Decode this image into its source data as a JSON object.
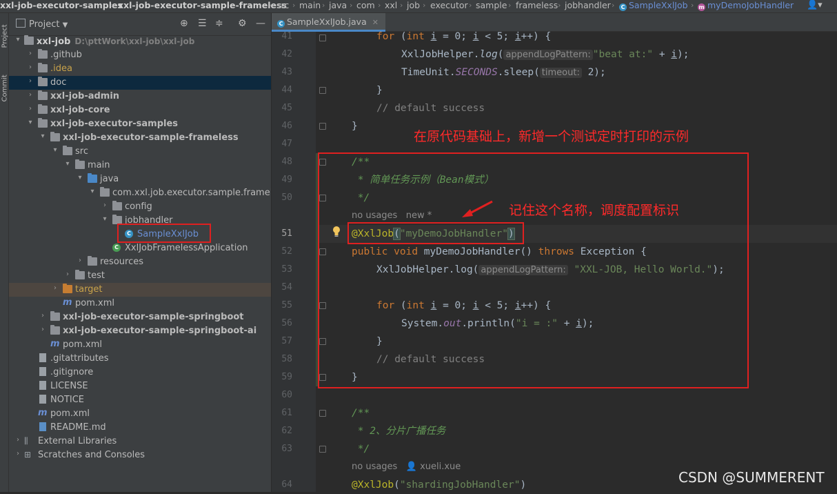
{
  "breadcrumb": {
    "items": [
      "xxl-job-executor-samples",
      "xxl-job-executor-sample-frameless",
      "src",
      "main",
      "java",
      "com",
      "xxl",
      "job",
      "executor",
      "sample",
      "frameless",
      "jobhandler",
      "SampleXxlJob",
      "myDemoJobHandler"
    ],
    "user_icon": "user-icon"
  },
  "toolstrip": {
    "project": "Project",
    "commit": "Commit"
  },
  "project_panel": {
    "title": "Project",
    "root": "xxl-job",
    "root_path": "D:\\pttWork\\xxl-job\\xxl-job",
    "tree": [
      ".github",
      ".idea",
      "doc",
      "xxl-job-admin",
      "xxl-job-core",
      "xxl-job-executor-samples",
      "xxl-job-executor-sample-frameless",
      "src",
      "main",
      "java",
      "com.xxl.job.executor.sample.frameless",
      "config",
      "jobhandler",
      "SampleXxlJob",
      "XxlJobFramelessApplication",
      "resources",
      "test",
      "target",
      "pom.xml",
      "xxl-job-executor-sample-springboot",
      "xxl-job-executor-sample-springboot-ai",
      "pom.xml",
      ".gitattributes",
      ".gitignore",
      "LICENSE",
      "NOTICE",
      "pom.xml",
      "README.md",
      "External Libraries",
      "Scratches and Consoles"
    ]
  },
  "editor": {
    "tab": "SampleXxlJob.java",
    "line_numbers": [
      "41",
      "42",
      "43",
      "44",
      "45",
      "46",
      "47",
      "48",
      "49",
      "50",
      "51",
      "52",
      "53",
      "54",
      "55",
      "56",
      "57",
      "58",
      "59",
      "60",
      "61",
      "62",
      "63",
      "64"
    ],
    "lines": {
      "l41_for": "for",
      "l41_int": "int",
      "l41_i": "i",
      "l41_rest": " = 0; ",
      "l41_i2": "i",
      "l41_lt": " < 5; ",
      "l41_i3": "i",
      "l41_end": "++) {",
      "l42_call": "XxlJobHelper.",
      "l42_log": "log",
      "l42_open": "(",
      "l42_hint": "appendLogPattern:",
      "l42_str": "\"beat at:\"",
      "l42_plus": " + ",
      "l42_i": "i",
      "l42_end": ");",
      "l43_tu": "TimeUnit.",
      "l43_sec": "SECONDS",
      "l43_sleep": ".sleep(",
      "l43_hint": "timeout:",
      "l43_end": " 2);",
      "l44": "}",
      "l45": "// default success",
      "l46": "}",
      "l48": "/**",
      "l49": " * 简单任务示例（Bean模式）",
      "l50": " */",
      "usage1_a": "no usages",
      "usage1_b": "new *",
      "l51_ann": "@XxlJob",
      "l51_open": "(",
      "l51_str": "\"myDemoJobHandler\"",
      "l51_close": ")",
      "l52_public": "public",
      "l52_void": "void",
      "l52_name": " myDemoJobHandler() ",
      "l52_throws": "throws",
      "l52_end": " Exception {",
      "l53_call": "XxlJobHelper.log(",
      "l53_hint": "appendLogPattern:",
      "l53_str": "\"XXL-JOB, Hello World.\"",
      "l53_end": ");",
      "l55_for": "for",
      "l55_int": "int",
      "l55_i": "i",
      "l55_rest": " = 0; ",
      "l55_i2": "i",
      "l55_lt": " < 5; ",
      "l55_i3": "i",
      "l55_end": "++) {",
      "l56_sys": "System.",
      "l56_out": "out",
      "l56_pr": ".println(",
      "l56_str": "\"i = :\"",
      "l56_plus": " + ",
      "l56_i": "i",
      "l56_end": ");",
      "l57": "}",
      "l58": "// default success",
      "l59": "}",
      "l61": "/**",
      "l62": " * 2、分片广播任务",
      "l63": " */",
      "usage2_a": "no usages",
      "usage2_b": "xueli.xue",
      "l64_ann": "@XxlJob",
      "l64_open": "(",
      "l64_str": "\"shardingJobHandler\"",
      "l64_close": ")"
    }
  },
  "annotations": {
    "note_top": "在原代码基础上，新增一个测试定时打印的示例",
    "note_name": "记住这个名称，调度配置标识"
  },
  "watermark": "CSDN @SUMMERENT",
  "colors": {
    "annotation_red": "#e02020",
    "selection": "#0d293e",
    "accent": "#4a88c7"
  }
}
